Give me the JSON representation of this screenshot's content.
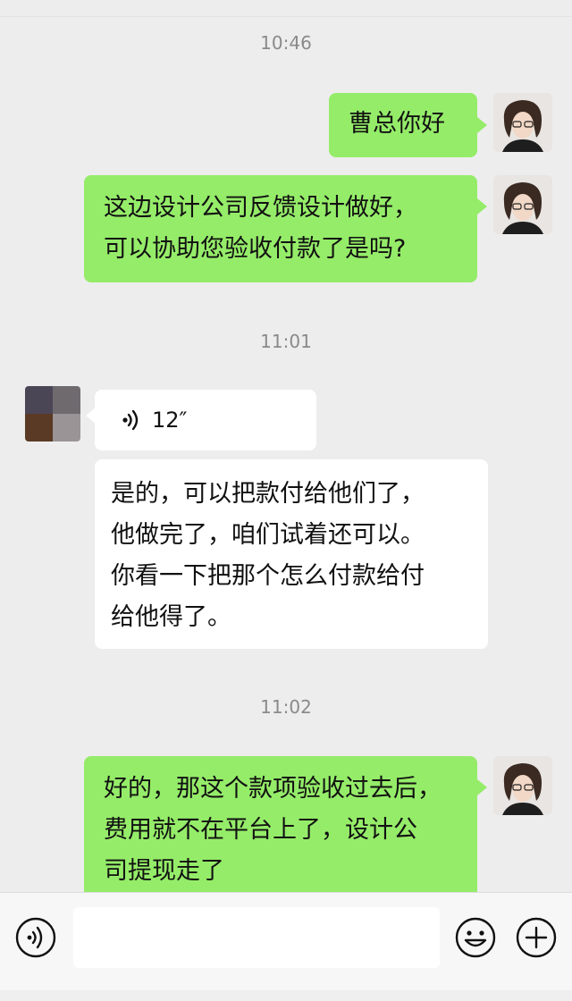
{
  "timestamps": [
    "10:46",
    "11:01",
    "11:02"
  ],
  "messages": {
    "m1": {
      "lines": [
        "曹总你好"
      ]
    },
    "m2": {
      "lines": [
        "这边设计公司反馈设计做好，",
        "可以协助您验收付款了是吗?"
      ]
    },
    "m3": {
      "duration": "12″"
    },
    "m4": {
      "lines": [
        "是的，可以把款付给他们了，",
        "他做完了，咱们试着还可以。",
        "你看一下把那个怎么付款给付",
        "给他得了。"
      ]
    },
    "m5": {
      "lines": [
        "好的，那这个款项验收过去后，",
        "费用就不在平台上了，设计公",
        "司提现走了"
      ]
    }
  },
  "icons": {
    "voice_input": "voice-icon",
    "emoji": "emoji-icon",
    "more": "plus-icon"
  },
  "colors": {
    "background": "#ededed",
    "my_bubble": "#95ec69",
    "their_bubble": "#ffffff"
  }
}
